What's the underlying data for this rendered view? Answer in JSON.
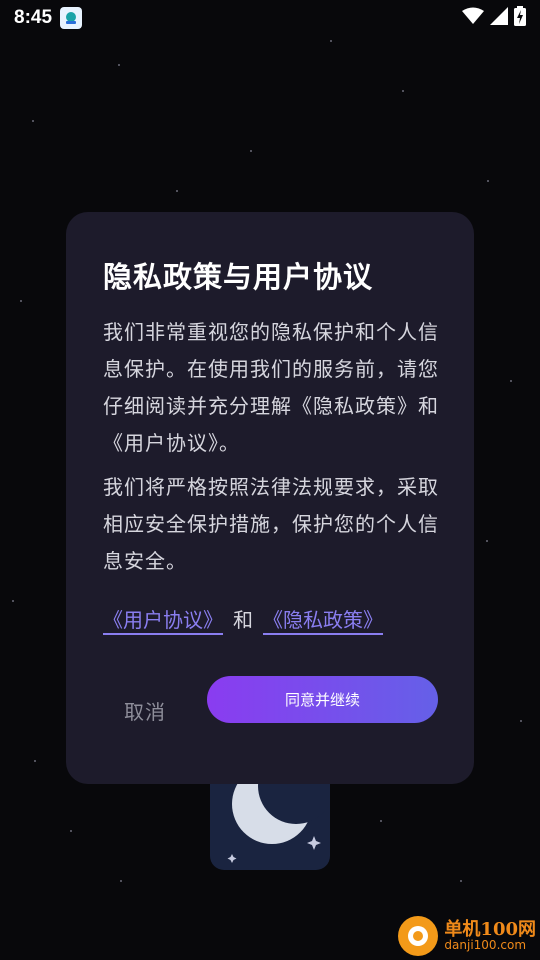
{
  "status_bar": {
    "time": "8:45",
    "icons": [
      "notification-app-icon",
      "wifi-icon",
      "signal-icon",
      "battery-charging-icon"
    ]
  },
  "dialog": {
    "title": "隐私政策与用户协议",
    "paragraphs": [
      "我们非常重视您的隐私保护和个人信息保护。在使用我们的服务前，请您仔细阅读并充分理解《隐私政策》和《用户协议》。",
      "我们将严格按照法律法规要求，采取相应安全保护措施，保护您的个人信息安全。"
    ],
    "links": {
      "user_agreement": "《用户协议》",
      "separator": "和",
      "privacy_policy": "《隐私政策》"
    },
    "buttons": {
      "cancel": "取消",
      "agree": "同意并继续"
    }
  },
  "watermark": {
    "name": "单机100网",
    "url": "danji100.com"
  },
  "colors": {
    "background": "#08080b",
    "dialog_bg": "#1d1b2b",
    "link": "#8a7ef0",
    "button_gradient_start": "#8a3cf0",
    "button_gradient_end": "#6560e8",
    "watermark": "#f08a1a"
  }
}
